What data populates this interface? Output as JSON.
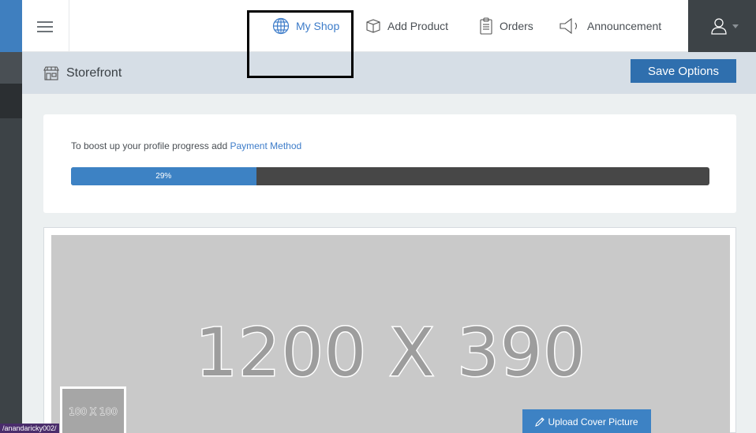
{
  "topbar": {
    "nav": [
      {
        "label": "My Shop",
        "icon": "globe-icon",
        "active": true
      },
      {
        "label": "Add Product",
        "icon": "box-icon"
      },
      {
        "label": "Orders",
        "icon": "clipboard-icon"
      },
      {
        "label": "Announcement",
        "icon": "megaphone-icon"
      }
    ],
    "user_icon": "user-icon"
  },
  "subbar": {
    "title": "Storefront",
    "title_icon": "store-icon",
    "save_label": "Save Options"
  },
  "progress_card": {
    "message_prefix": "To boost up your profile progress add ",
    "message_link": "Payment Method",
    "progress_label": "29%",
    "progress_value": 0.29
  },
  "cover": {
    "placeholder_text": "1200 X 390",
    "avatar_placeholder_text": "100 X 100",
    "upload_label": "Upload Cover Picture"
  },
  "status_url": "/anandaricky002/",
  "colors": {
    "accent": "#3d82c4",
    "sidebar": "#3d4347",
    "subbar": "#d6dee6"
  }
}
